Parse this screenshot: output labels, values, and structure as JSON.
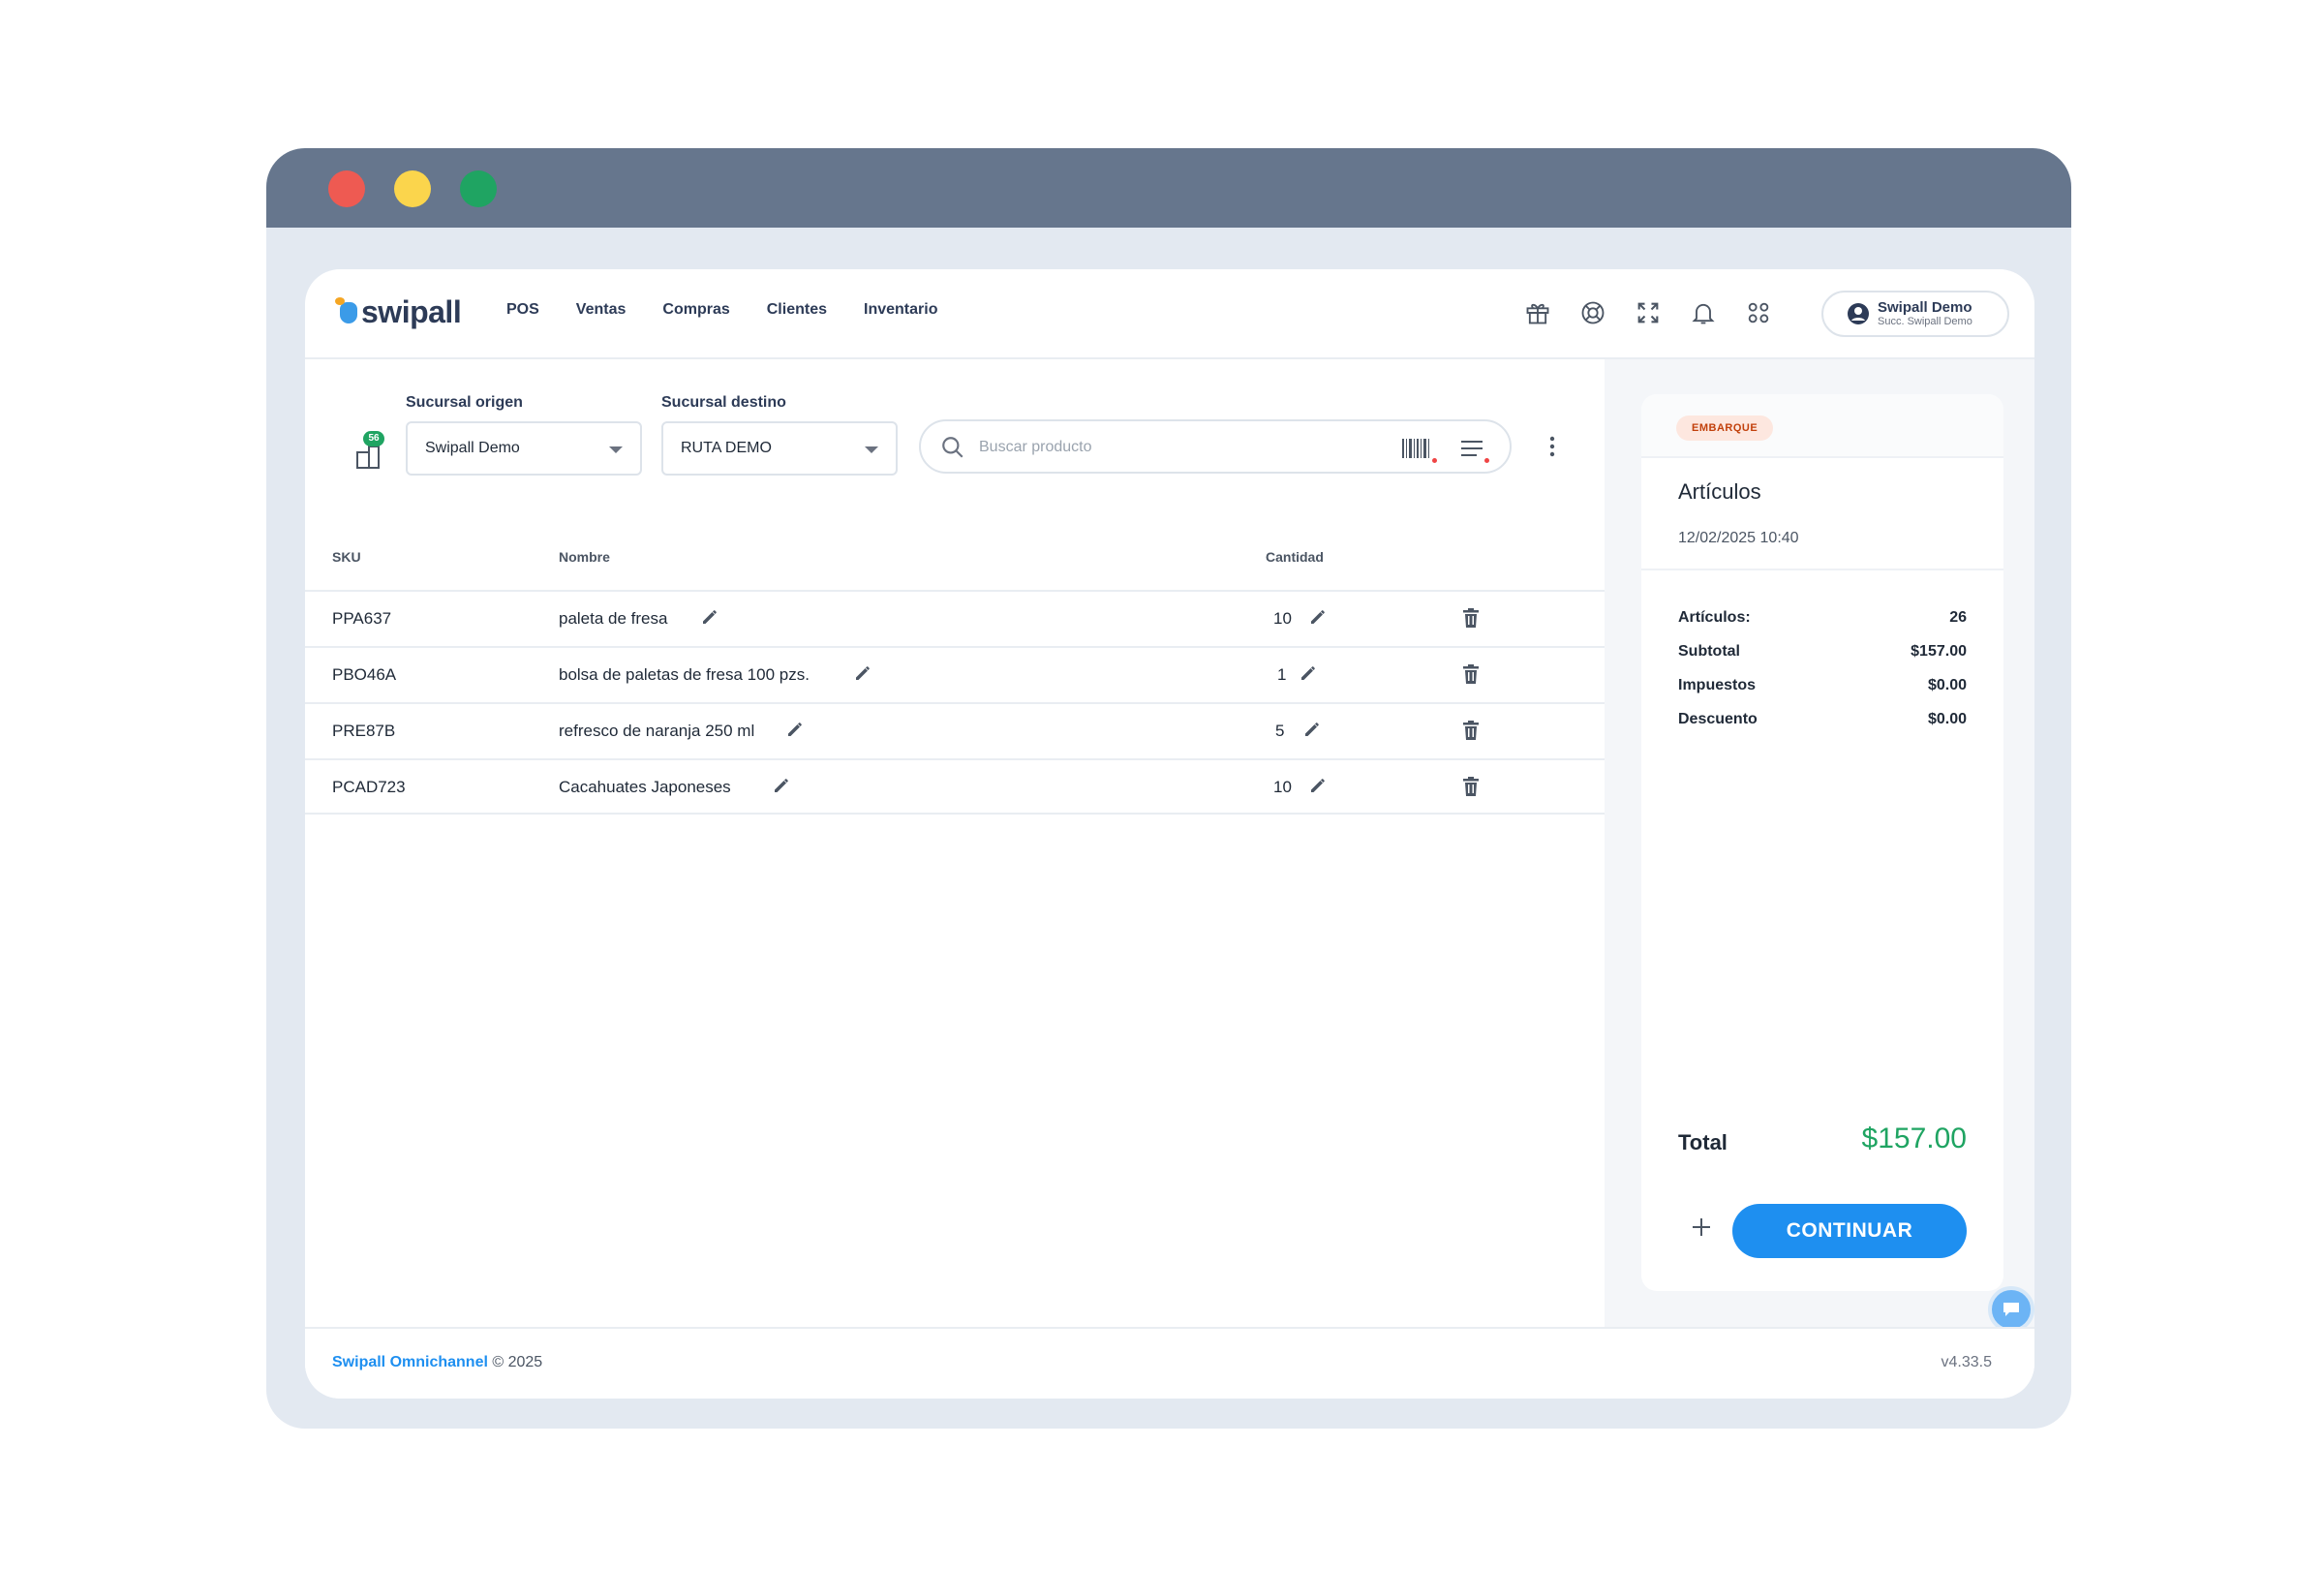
{
  "app": {
    "logo_text": "swipall",
    "nav": [
      "POS",
      "Ventas",
      "Compras",
      "Clientes",
      "Inventario"
    ],
    "user": {
      "name": "Swipall Demo",
      "branch": "Succ. Swipall Demo"
    },
    "icons": [
      "gift-icon",
      "help-icon",
      "fullscreen-icon",
      "bell-icon",
      "apps-icon"
    ]
  },
  "controls": {
    "badge_count": "56",
    "origin_label": "Sucursal origen",
    "origin_value": "Swipall Demo",
    "dest_label": "Sucursal destino",
    "dest_value": "RUTA DEMO",
    "search_placeholder": "Buscar producto"
  },
  "table": {
    "headers": {
      "sku": "SKU",
      "name": "Nombre",
      "qty": "Cantidad"
    },
    "rows": [
      {
        "sku": "PPA637",
        "name": "paleta de fresa",
        "qty": "10"
      },
      {
        "sku": "PBO46A",
        "name": "bolsa de paletas de fresa 100 pzs.",
        "qty": "1"
      },
      {
        "sku": "PRE87B",
        "name": "refresco de naranja 250 ml",
        "qty": "5"
      },
      {
        "sku": "PCAD723",
        "name": "Cacahuates Japoneses",
        "qty": "10"
      }
    ]
  },
  "summary": {
    "tag": "EMBARQUE",
    "title": "Artículos",
    "date": "12/02/2025 10:40",
    "lines": [
      {
        "label": "Artículos:",
        "value": "26"
      },
      {
        "label": "Subtotal",
        "value": "$157.00"
      },
      {
        "label": "Impuestos",
        "value": "$0.00"
      },
      {
        "label": "Descuento",
        "value": "$0.00"
      }
    ],
    "total_label": "Total",
    "total_value": "$157.00",
    "continue_label": "CONTINUAR"
  },
  "footer": {
    "brand": "Swipall Omnichannel",
    "copyright": " © 2025",
    "version": "v4.33.5"
  },
  "colors": {
    "accent": "#1e8ff0",
    "success": "#1fa462",
    "titlebar": "#66768d",
    "tag_bg": "#fde7df"
  }
}
